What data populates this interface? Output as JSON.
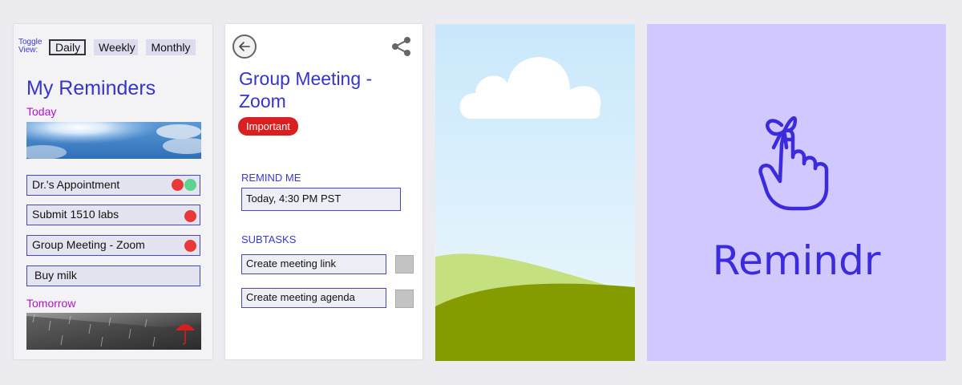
{
  "reminders_screen": {
    "toggle_label_line1": "Toggle",
    "toggle_label_line2": "View:",
    "views": [
      "Daily",
      "Weekly",
      "Monthly"
    ],
    "active_view": "Daily",
    "title": "My Reminders",
    "today_label": "Today",
    "items": [
      {
        "label": "Dr.'s Appointment",
        "dots": [
          "#e8393a",
          "#5ed38e"
        ]
      },
      {
        "label": "Submit 1510 labs",
        "dots": [
          "#e8393a"
        ]
      },
      {
        "label": "Group Meeting - Zoom",
        "dots": [
          "#e8393a"
        ]
      },
      {
        "label": "Buy milk",
        "dots": []
      }
    ],
    "tomorrow_label": "Tomorrow"
  },
  "detail_screen": {
    "back_icon": "arrow-left-circle-icon",
    "share_icon": "share-icon",
    "title": "Group Meeting - Zoom",
    "badge": "Important",
    "badge_color": "#d91f1f",
    "remind_label": "REMIND ME",
    "remind_value": "Today, 4:30 PM PST",
    "subtasks_label": "SUBTASKS",
    "subtasks": [
      "Create meeting link",
      "Create meeting agenda"
    ]
  },
  "splash": {
    "brand": "Remindr",
    "logo_icon": "finger-with-ribbon-icon",
    "brand_color": "#3c2bdc",
    "background": "#d0c8ff"
  },
  "colors": {
    "accent": "#3535cc",
    "day_label": "#b012c8"
  }
}
